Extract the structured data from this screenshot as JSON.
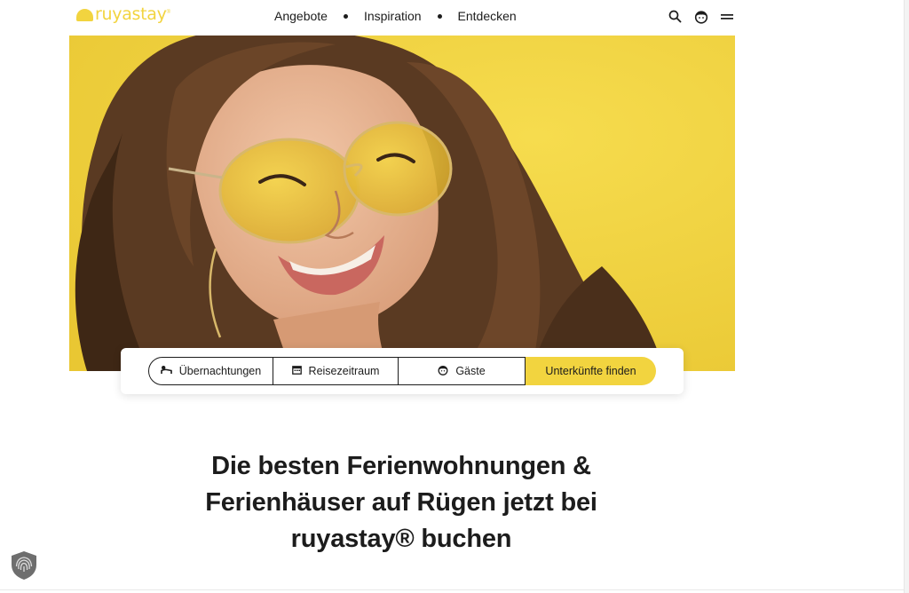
{
  "brand": {
    "name": "ruyastay",
    "reg": "®",
    "color": "#f2d43f"
  },
  "nav": {
    "items": [
      {
        "label": "Angebote"
      },
      {
        "label": "Inspiration"
      },
      {
        "label": "Entdecken"
      }
    ]
  },
  "header_icons": [
    "search-icon",
    "user-face-icon",
    "menu-icon"
  ],
  "hero": {
    "background_color": "#f2d43f",
    "image": "smiling-woman-yellow-sunglasses"
  },
  "search": {
    "nights_label": "Übernachtungen",
    "dates_label": "Reisezeitraum",
    "guests_label": "Gäste",
    "submit_label": "Unterkünfte finden",
    "accent": "#f2d43f"
  },
  "headline": {
    "line1": "Die besten Ferienwohnungen &",
    "line2": "Ferienhäuser auf Rügen jetzt bei",
    "line3": "ruyastay® buchen"
  },
  "badge": {
    "icon": "shield-fingerprint-icon"
  }
}
